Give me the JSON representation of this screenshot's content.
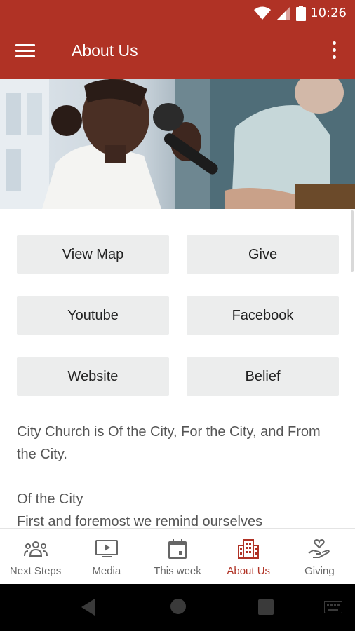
{
  "status": {
    "time": "10:26"
  },
  "app_bar": {
    "title": "About Us"
  },
  "buttons": [
    {
      "label": "View Map"
    },
    {
      "label": "Give"
    },
    {
      "label": "Youtube"
    },
    {
      "label": "Facebook"
    },
    {
      "label": "Website"
    },
    {
      "label": "Belief"
    }
  ],
  "about": {
    "intro": "City Church is Of the City, For the City, and From the City.",
    "section_title": "Of the City",
    "section_body": "First and foremost we remind ourselves"
  },
  "bottom_nav": {
    "items": [
      {
        "label": "Next Steps",
        "icon": "group-icon"
      },
      {
        "label": "Media",
        "icon": "play-icon"
      },
      {
        "label": "This week",
        "icon": "calendar-icon"
      },
      {
        "label": "About Us",
        "icon": "building-icon",
        "active": true
      },
      {
        "label": "Giving",
        "icon": "hand-heart-icon"
      }
    ]
  },
  "colors": {
    "primary": "#b03225",
    "button_bg": "#eceded",
    "text": "#555555"
  }
}
